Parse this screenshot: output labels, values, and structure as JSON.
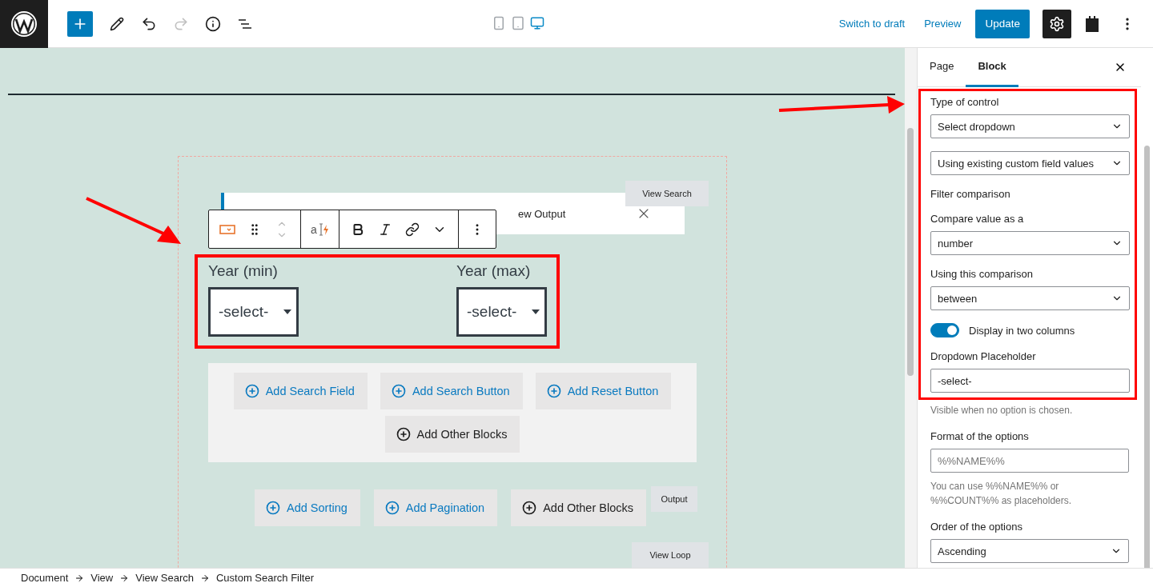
{
  "header": {
    "devices": [
      {
        "kind": "mobile",
        "selected": false
      },
      {
        "kind": "tablet",
        "selected": false
      },
      {
        "kind": "desktop",
        "selected": true
      }
    ],
    "switch_to_draft": "Switch to draft",
    "preview": "Preview",
    "update": "Update",
    "settings": {
      "selected": true
    }
  },
  "canvas": {
    "notice_text": "ew Output",
    "tags": {
      "view_search": "View Search",
      "output": "Output",
      "view_loop": "View Loop"
    },
    "toolbar": {
      "dynamic_label": "a"
    },
    "filter_fields": [
      {
        "label": "Year (min)",
        "value": "-select-"
      },
      {
        "label": "Year (max)",
        "value": "-select-"
      }
    ],
    "search_buttons": [
      {
        "kind": "add",
        "label": "Add Search Field"
      },
      {
        "kind": "add",
        "label": "Add Search Button"
      },
      {
        "kind": "add",
        "label": "Add Reset Button"
      },
      {
        "kind": "other",
        "label": "Add Other Blocks"
      }
    ],
    "output_buttons": [
      {
        "kind": "add",
        "label": "Add Sorting"
      },
      {
        "kind": "add",
        "label": "Add Pagination"
      },
      {
        "kind": "other",
        "label": "Add Other Blocks"
      }
    ]
  },
  "sidebar": {
    "tabs": [
      {
        "label": "Page",
        "selected": false
      },
      {
        "label": "Block",
        "selected": true
      }
    ],
    "highlighted_controls": [
      {
        "kind": "select",
        "label": "Type of control",
        "value": "Select dropdown"
      },
      {
        "kind": "select",
        "value": "Using existing custom field values"
      },
      {
        "kind": "heading",
        "label": "Filter comparison"
      },
      {
        "kind": "select",
        "label": "Compare value as a",
        "value": "number"
      },
      {
        "kind": "select",
        "label": "Using this comparison",
        "value": "between"
      },
      {
        "kind": "toggle",
        "label": "Display in two columns",
        "on": true
      },
      {
        "kind": "input",
        "label": "Dropdown Placeholder",
        "value": "-select-"
      }
    ],
    "controls": [
      {
        "kind": "help",
        "label": "Visible when no option is chosen."
      },
      {
        "kind": "input",
        "label": "Format of the options",
        "placeholder": "%%NAME%%",
        "help": "You can use %%NAME%% or %%COUNT%% as placeholders."
      },
      {
        "kind": "select",
        "label": "Order of the options",
        "value": "Ascending"
      }
    ]
  },
  "breadcrumbs": [
    "Document",
    "View",
    "View Search",
    "Custom Search Filter"
  ]
}
